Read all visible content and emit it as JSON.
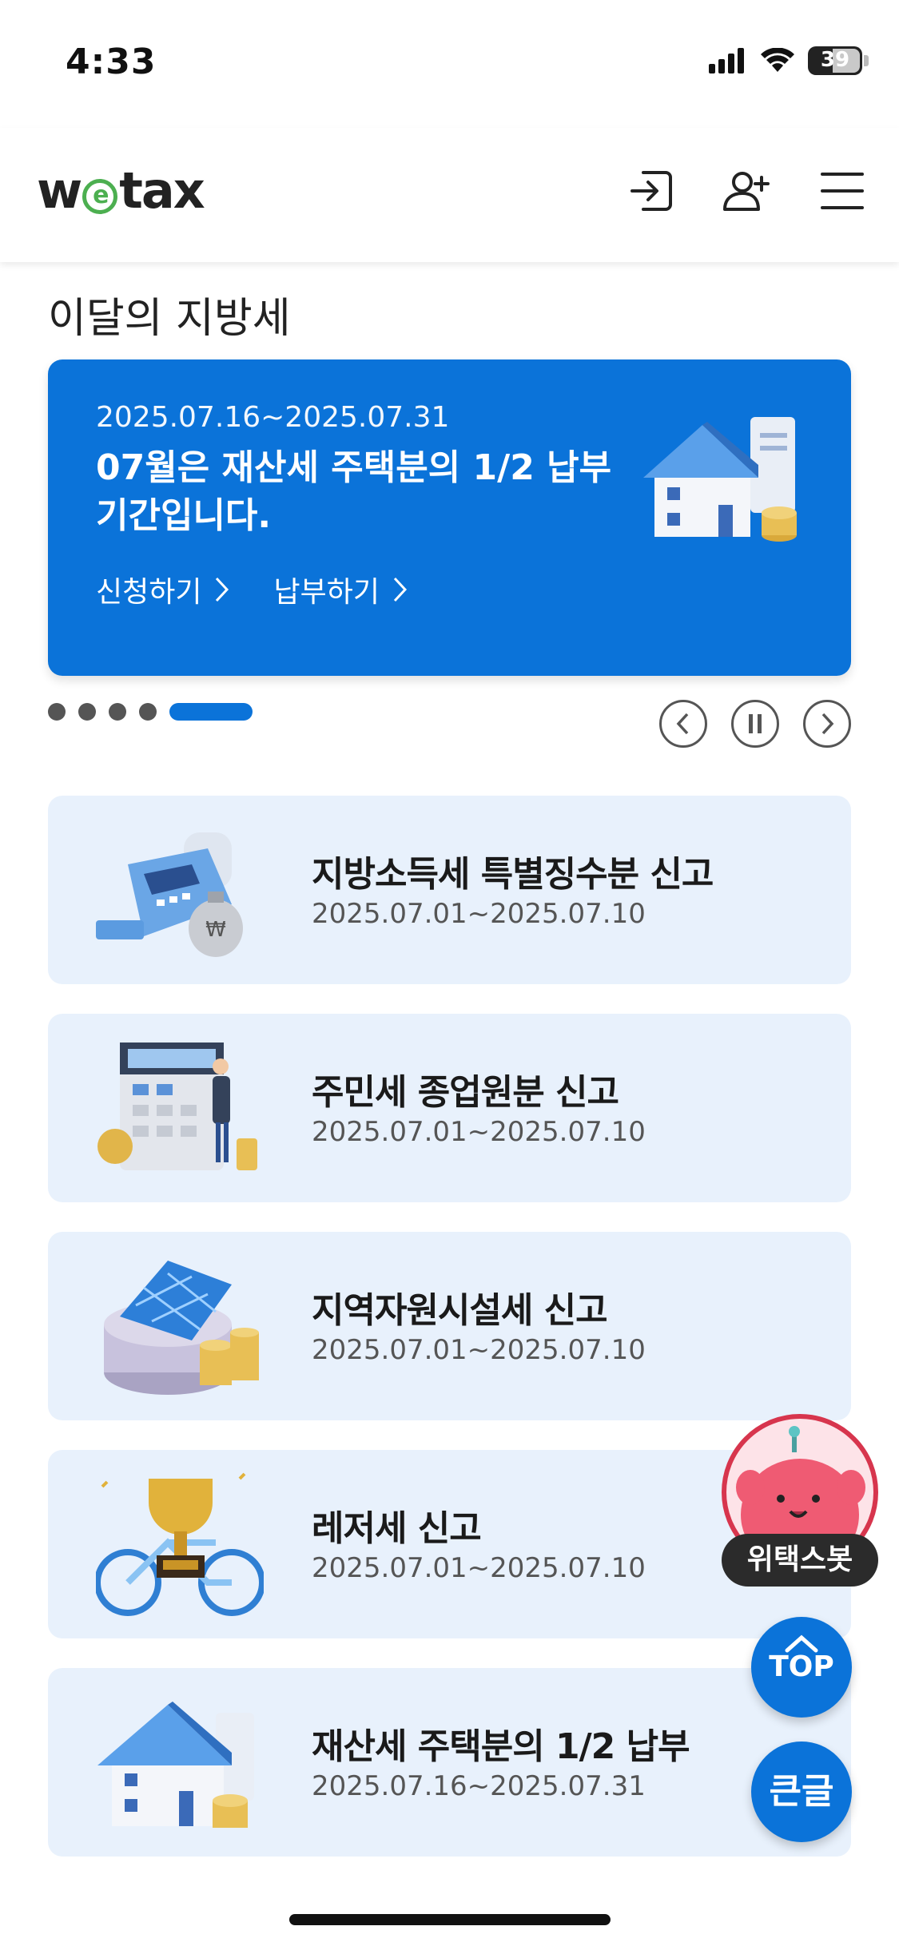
{
  "status_bar": {
    "time": "4:33",
    "battery": "39"
  },
  "header": {
    "logo": "wetax"
  },
  "section_title": "이달의 지방세",
  "banner": {
    "date": "2025.07.16~2025.07.31",
    "title": "07월은 재산세 주택분의 1/2 납부 기간입니다.",
    "link_apply": "신청하기",
    "link_pay": "납부하기",
    "background_color": "#0b73d9",
    "slide_index": 5,
    "slide_count": 5
  },
  "cards": [
    {
      "title": "지방소득세 특별징수분 신고",
      "date": "2025.07.01~2025.07.10",
      "icon": "card-terminal-icon"
    },
    {
      "title": "주민세 종업원분 신고",
      "date": "2025.07.01~2025.07.10",
      "icon": "calculator-icon"
    },
    {
      "title": "지역자원시설세 신고",
      "date": "2025.07.01~2025.07.10",
      "icon": "solar-panel-icon"
    },
    {
      "title": "레저세 신고",
      "date": "2025.07.01~2025.07.10",
      "icon": "trophy-bicycle-icon"
    },
    {
      "title": "재산세 주택분의 1/2 납부",
      "date": "2025.07.16~2025.07.31",
      "icon": "house-coins-icon"
    }
  ],
  "floating": {
    "bot_label": "위택스봇",
    "top_label": "TOP",
    "big_text_label": "큰글"
  }
}
